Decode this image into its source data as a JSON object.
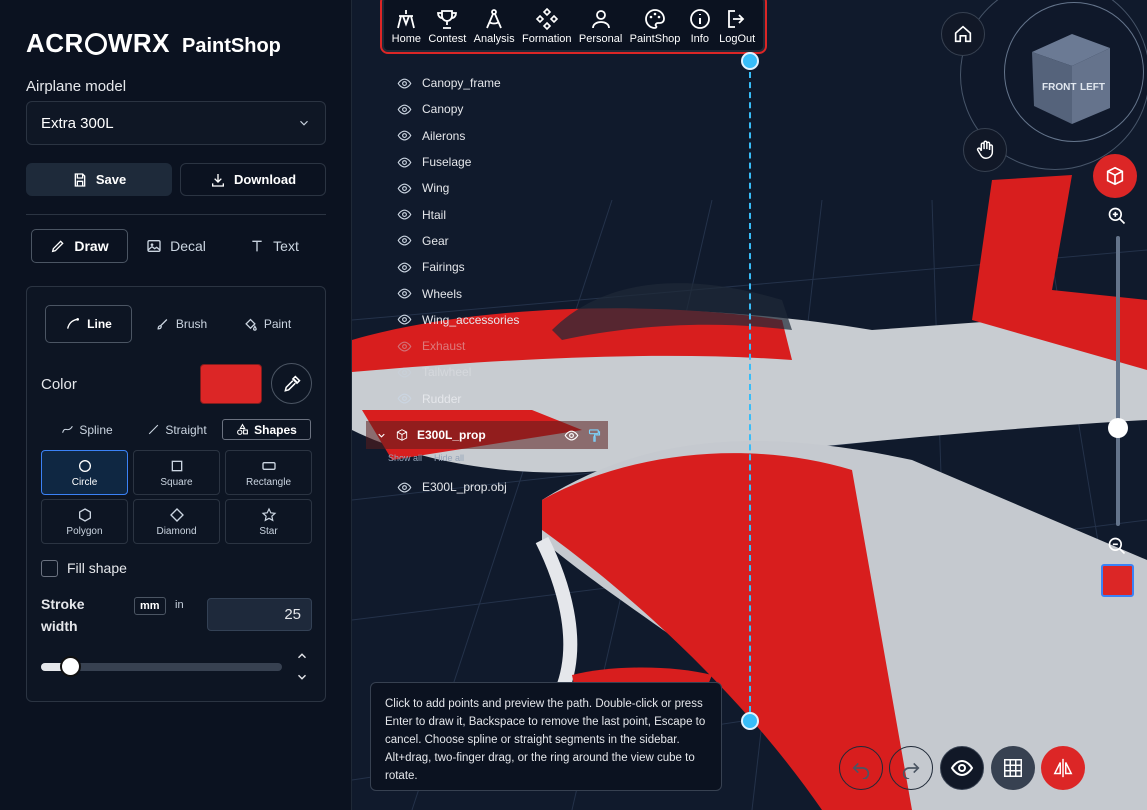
{
  "brand": {
    "logo_pre": "ACR",
    "logo_post": "WRX",
    "app": "PaintShop"
  },
  "model": {
    "label": "Airplane model",
    "value": "Extra 300L"
  },
  "actions": {
    "save": "Save",
    "download": "Download"
  },
  "tabs": [
    {
      "label": "Draw"
    },
    {
      "label": "Decal"
    },
    {
      "label": "Text"
    }
  ],
  "tools": [
    {
      "label": "Line"
    },
    {
      "label": "Brush"
    },
    {
      "label": "Paint"
    }
  ],
  "color": {
    "label": "Color",
    "value": "#dc2626"
  },
  "modes": [
    {
      "label": "Spline"
    },
    {
      "label": "Straight"
    },
    {
      "label": "Shapes"
    }
  ],
  "shapes": [
    {
      "label": "Circle"
    },
    {
      "label": "Square"
    },
    {
      "label": "Rectangle"
    },
    {
      "label": "Polygon"
    },
    {
      "label": "Diamond"
    },
    {
      "label": "Star"
    }
  ],
  "fill_shape": "Fill shape",
  "stroke": {
    "label_line1": "Stroke",
    "label_line2": "width",
    "unit_mm": "mm",
    "unit_in": "in",
    "value": "25",
    "slider_fraction": 0.12
  },
  "nav": [
    {
      "label": "Home"
    },
    {
      "label": "Contest"
    },
    {
      "label": "Analysis"
    },
    {
      "label": "Formation"
    },
    {
      "label": "Personal"
    },
    {
      "label": "PaintShop"
    },
    {
      "label": "Info"
    },
    {
      "label": "LogOut"
    }
  ],
  "parts": [
    "Canopy_frame",
    "Canopy",
    "Ailerons",
    "Fuselage",
    "Wing",
    "Htail",
    "Gear",
    "Fairings",
    "Wheels",
    "Wing_accessories",
    "Exhaust",
    "Tailwheel",
    "Rudder"
  ],
  "group": {
    "name": "E300L_prop",
    "show_all": "Show all",
    "hide_all": "Hide all",
    "child": "E300L_prop.obj"
  },
  "viewcube": {
    "front": "FRONT",
    "left": "LEFT"
  },
  "hint": "Click to add points and preview the path. Double-click or press Enter to draw it, Backspace to remove the last point, Escape to cancel. Choose spline or straight segments in the sidebar. Alt+drag, two-finger drag, or the ring around the view cube to rotate.",
  "colors": {
    "accent": "#dc2626",
    "guide": "#38bdf8",
    "background": "#0b1220"
  }
}
